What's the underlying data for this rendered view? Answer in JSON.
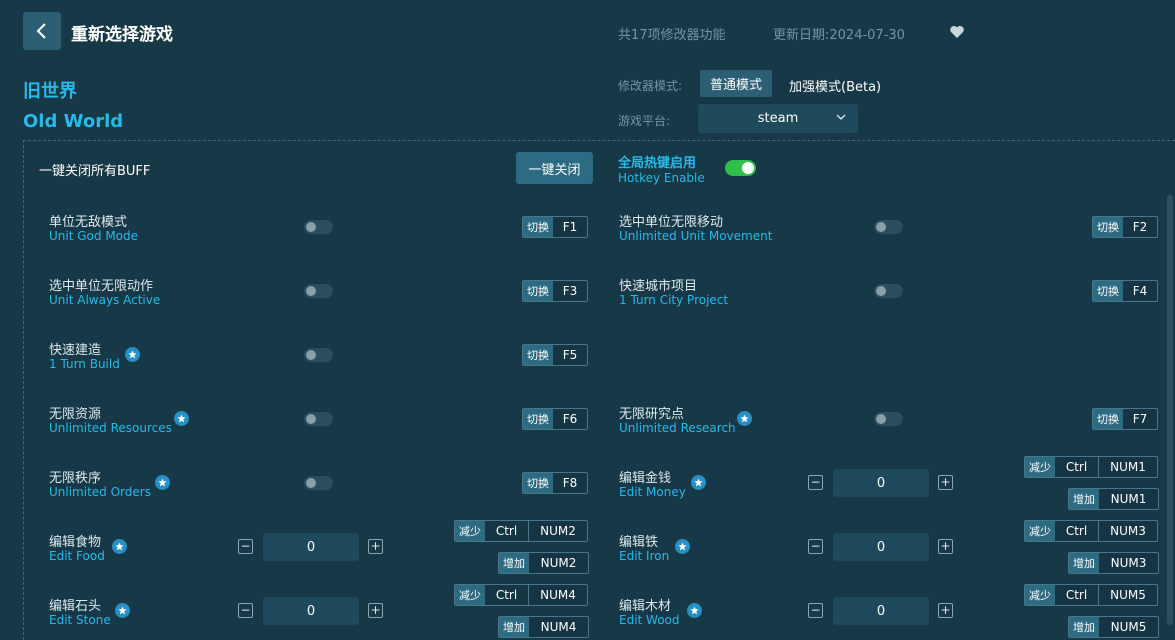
{
  "header": {
    "title": "重新选择游戏",
    "mod_count": "共17项修改器功能",
    "update_date": "更新日期:2024-07-30"
  },
  "game": {
    "name_cn": "旧世界",
    "name_en": "Old World"
  },
  "mode": {
    "label": "修改器模式:",
    "normal": "普通模式",
    "enhanced": "加强模式(Beta)"
  },
  "platform": {
    "label": "游戏平台:",
    "value": "steam"
  },
  "buff": {
    "label": "一键关闭所有BUFF",
    "button": "一键关闭"
  },
  "hotkey": {
    "label_cn": "全局热键启用",
    "label_en": "Hotkey Enable",
    "enabled": true
  },
  "tags": {
    "switch": "切换",
    "decrease": "减少",
    "increase": "增加"
  },
  "cheats": [
    {
      "cn": "单位无敌模式",
      "en": "Unit God Mode",
      "star": false,
      "key": "F1"
    },
    {
      "cn": "选中单位无限移动",
      "en": "Unlimited Unit Movement",
      "star": false,
      "key": "F2"
    },
    {
      "cn": "选中单位无限动作",
      "en": "Unit Always Active",
      "star": false,
      "key": "F3"
    },
    {
      "cn": "快速城市项目",
      "en": "1 Turn City Project",
      "star": false,
      "key": "F4"
    },
    {
      "cn": "快速建造",
      "en": "1 Turn Build",
      "star": true,
      "key": "F5"
    },
    {
      "cn": "无限资源",
      "en": "Unlimited Resources",
      "star": true,
      "key": "F6"
    },
    {
      "cn": "无限研究点",
      "en": "Unlimited Research",
      "star": true,
      "key": "F7"
    },
    {
      "cn": "无限秩序",
      "en": "Unlimited Orders",
      "star": true,
      "key": "F8"
    }
  ],
  "editors": [
    {
      "cn": "编辑金钱",
      "en": "Edit Money",
      "value": "0",
      "mod": "Ctrl",
      "dec": "NUM1",
      "inc": "NUM1"
    },
    {
      "cn": "编辑食物",
      "en": "Edit Food",
      "value": "0",
      "mod": "Ctrl",
      "dec": "NUM2",
      "inc": "NUM2"
    },
    {
      "cn": "编辑铁",
      "en": "Edit Iron",
      "value": "0",
      "mod": "Ctrl",
      "dec": "NUM3",
      "inc": "NUM3"
    },
    {
      "cn": "编辑石头",
      "en": "Edit Stone",
      "value": "0",
      "mod": "Ctrl",
      "dec": "NUM4",
      "inc": "NUM4"
    },
    {
      "cn": "编辑木材",
      "en": "Edit Wood",
      "value": "0",
      "mod": "Ctrl",
      "dec": "NUM5",
      "inc": "NUM5"
    }
  ],
  "stepper": {
    "minus": "−",
    "plus": "+"
  }
}
